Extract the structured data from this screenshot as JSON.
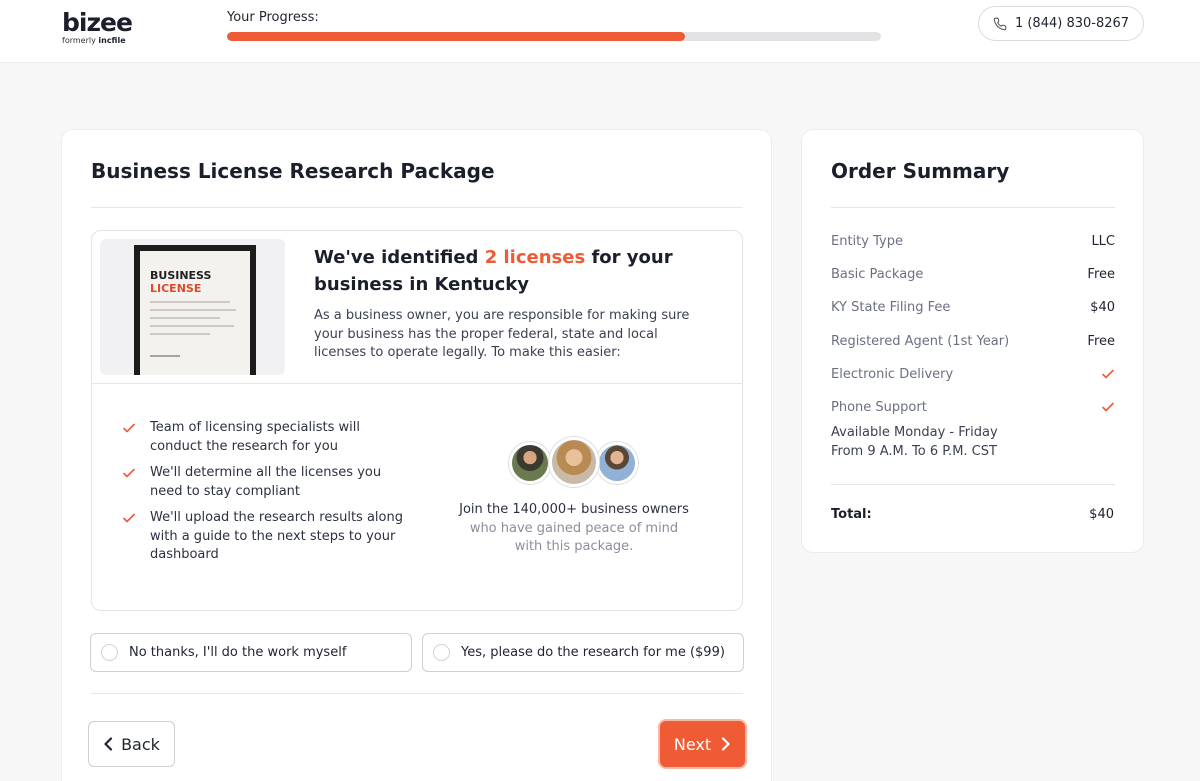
{
  "header": {
    "logo_text": "bizee",
    "logo_sub_prefix": "formerly",
    "logo_sub_brand": "incfile",
    "progress_label": "Your Progress:",
    "progress_percent": 70,
    "phone": "1 (844) 830-8267"
  },
  "main": {
    "title": "Business License Research Package",
    "thumbnail": {
      "line1": "BUSINESS",
      "line2": "LICENSE"
    },
    "headline": {
      "prefix": "We've identified",
      "highlight": "2 licenses",
      "suffix": "for your business in Kentucky"
    },
    "intro": "As a business owner, you are responsible for making sure your business has the proper federal, state and local licenses to operate legally. To make this easier:",
    "benefits": [
      "Team of licensing specialists will conduct the research for you",
      "We'll determine all the licenses you need to stay compliant",
      "We'll upload the research results along with a guide to the next steps to your dashboard"
    ],
    "social_proof": {
      "strong": "Join the 140,000+ business owners",
      "rest": "who have gained peace of mind with this package."
    },
    "options": [
      {
        "label": "No thanks, I'll do the work myself",
        "selected": false
      },
      {
        "label": "Yes, please do the research for me ($99)",
        "selected": false
      }
    ],
    "back_label": "Back",
    "next_label": "Next"
  },
  "summary": {
    "title": "Order Summary",
    "rows": [
      {
        "label": "Entity Type",
        "value": "LLC"
      },
      {
        "label": "Basic Package",
        "value": "Free"
      },
      {
        "label": "KY State Filing Fee",
        "value": "$40"
      },
      {
        "label": "Registered Agent (1st Year)",
        "value": "Free"
      },
      {
        "label": "Electronic Delivery",
        "value": "check"
      },
      {
        "label": "Phone Support",
        "value": "check"
      }
    ],
    "availability": "Available Monday - Friday From 9 A.M. To 6 P.M. CST",
    "total_label": "Total:",
    "total_value": "$40"
  },
  "colors": {
    "accent": "#ee5b34",
    "text": "#1f2430",
    "muted": "#6b7080"
  }
}
